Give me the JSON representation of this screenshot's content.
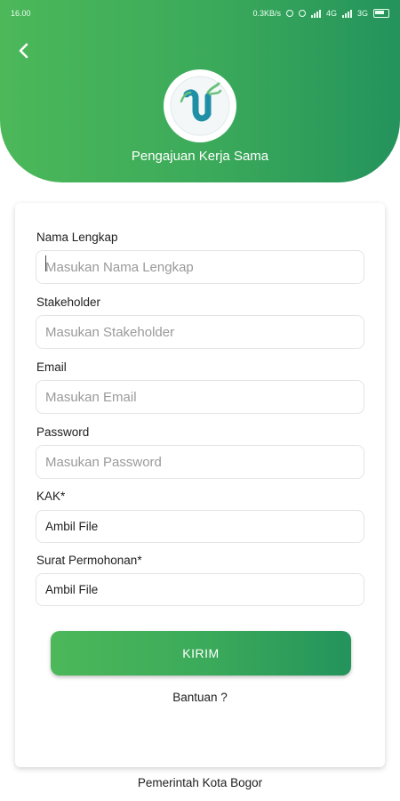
{
  "status_bar": {
    "time": "16.00",
    "net_speed": "0.3KB/s",
    "network_1": "4G",
    "network_2": "3G"
  },
  "header": {
    "title": "Pengajuan Kerja Sama",
    "logo_icon": "circle-u-logo-icon",
    "back_icon": "chevron-left-icon"
  },
  "form": {
    "fields": [
      {
        "label": "Nama Lengkap",
        "placeholder": "Masukan Nama Lengkap"
      },
      {
        "label": "Stakeholder",
        "placeholder": "Masukan Stakeholder"
      },
      {
        "label": "Email",
        "placeholder": "Masukan Email"
      },
      {
        "label": "Password",
        "placeholder": "Masukan Password"
      }
    ],
    "files": [
      {
        "label": "KAK*",
        "value": "Ambil File"
      },
      {
        "label": "Surat Permohonan*",
        "value": "Ambil File"
      }
    ],
    "submit_label": "KIRIM",
    "help_label": "Bantuan ?"
  },
  "footer": {
    "text": "Pemerintah Kota Bogor"
  },
  "colors": {
    "brand_green_start": "#4cb85a",
    "brand_green_end": "#24935c",
    "logo_teal": "#1f8fa6",
    "logo_green": "#67c17a"
  }
}
